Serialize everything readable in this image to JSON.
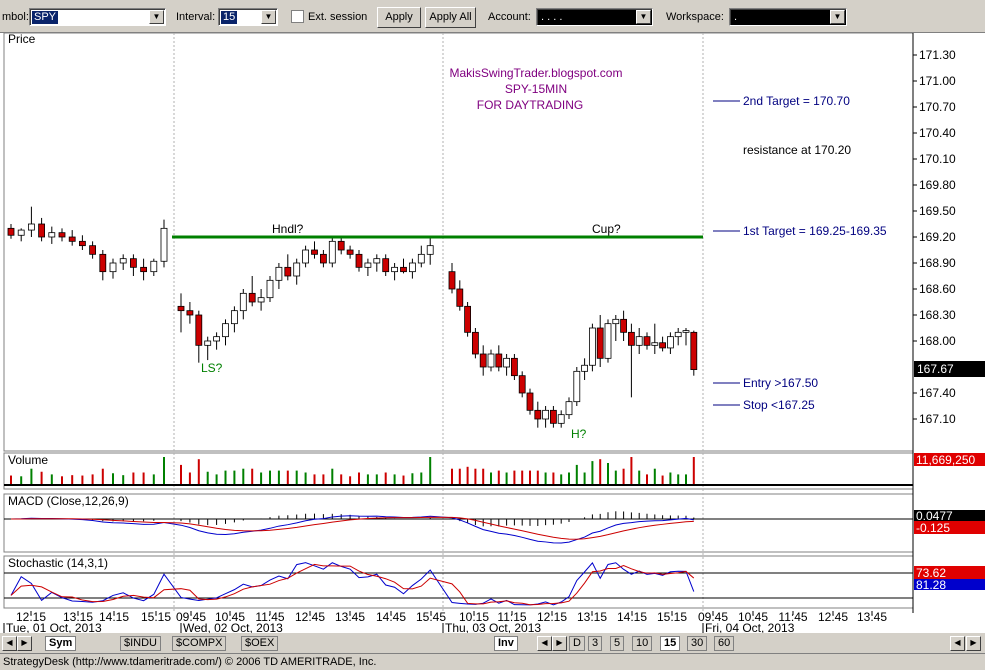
{
  "toolbar": {
    "symbol_label": "mbol:",
    "symbol_value": "SPY",
    "interval_label": "Interval:",
    "interval_value": "15",
    "ext_session_label": "Ext. session",
    "apply_label": "Apply",
    "apply_all_label": "Apply All",
    "account_label": "Account:",
    "account_value": ".   .   .   .",
    "workspace_label": "Workspace:",
    "workspace_value": "."
  },
  "price_panel": {
    "label": "Price",
    "watermark": [
      "MakisSwingTrader.blogspot.com",
      "SPY-15MIN",
      "FOR DAYTRADING"
    ],
    "price_ticks": [
      "171.30",
      "171.00",
      "170.70",
      "170.40",
      "170.10",
      "169.80",
      "169.50",
      "169.20",
      "168.90",
      "168.60",
      "168.30",
      "168.00",
      "167.40",
      "167.10"
    ],
    "last_price": "167.67",
    "annotations": {
      "second_target": "2nd Target = 170.70",
      "resistance": "resistance at 170.20",
      "first_target": "1st Target = 169.25-169.35",
      "entry": "Entry >167.50",
      "stop": "Stop <167.25",
      "handle": "Hndl?",
      "cup": "Cup?",
      "left_shoulder": "LS?",
      "head": "H?"
    },
    "neckline_price": 169.2
  },
  "volume_panel": {
    "label": "Volume",
    "last_value": "11,669,250"
  },
  "macd_panel": {
    "label": "MACD (Close,12,26,9)",
    "value1": "0.0477",
    "value2": "-0.125"
  },
  "stoch_panel": {
    "label": "Stochastic (14,3,1)",
    "value1": "73.62",
    "value2": "81.28"
  },
  "time_axis": {
    "times": [
      "12:15",
      "13:15",
      "14:15",
      "15:15",
      "09:45",
      "10:45",
      "11:45",
      "12:45",
      "13:45",
      "14:45",
      "15:45",
      "10:15",
      "11:15",
      "12:15",
      "13:15",
      "14:15",
      "15:15",
      "09:45",
      "10:45",
      "11:45",
      "12:45",
      "13:45"
    ],
    "dates": [
      "Tue, 01 Oct, 2013",
      "Wed, 02 Oct, 2013",
      "Thu, 03 Oct, 2013",
      "Fri, 04 Oct, 2013"
    ]
  },
  "tabs": [
    "Sym",
    "$INDU",
    "$COMPX",
    "$OEX",
    "Inv",
    "D",
    "3",
    "5",
    "10",
    "15",
    "30",
    "60"
  ],
  "status": "StrategyDesk (http://www.tdameritrade.com/) © 2006 TD AMERITRADE, Inc.",
  "colors": {
    "up": "#ffffff",
    "down": "#cc0000",
    "neckline": "#008000",
    "macd": "#0000cc",
    "signal": "#cc0000",
    "watermark": "#800080",
    "annotation": "#000080"
  },
  "chart_data": {
    "type": "candlestick",
    "title": "",
    "ylim": [
      166.9,
      171.45
    ],
    "candles": [
      [
        169.3,
        169.35,
        169.18,
        169.22
      ],
      [
        169.22,
        169.3,
        169.15,
        169.28
      ],
      [
        169.28,
        169.55,
        169.2,
        169.35
      ],
      [
        169.35,
        169.42,
        169.15,
        169.2
      ],
      [
        169.2,
        169.32,
        169.12,
        169.25
      ],
      [
        169.25,
        169.3,
        169.15,
        169.2
      ],
      [
        169.2,
        169.28,
        169.1,
        169.15
      ],
      [
        169.15,
        169.22,
        169.05,
        169.1
      ],
      [
        169.1,
        169.15,
        168.95,
        169.0
      ],
      [
        169.0,
        169.05,
        168.7,
        168.8
      ],
      [
        168.8,
        168.95,
        168.72,
        168.9
      ],
      [
        168.9,
        169.0,
        168.82,
        168.95
      ],
      [
        168.95,
        169.0,
        168.75,
        168.85
      ],
      [
        168.85,
        168.95,
        168.7,
        168.8
      ],
      [
        168.8,
        168.95,
        168.75,
        168.92
      ],
      [
        168.92,
        169.4,
        168.85,
        169.3
      ],
      [
        168.4,
        168.55,
        168.1,
        168.35
      ],
      [
        168.35,
        168.45,
        168.2,
        168.3
      ],
      [
        168.3,
        168.35,
        167.75,
        167.95
      ],
      [
        167.95,
        168.05,
        167.78,
        168.0
      ],
      [
        168.0,
        168.1,
        167.9,
        168.05
      ],
      [
        168.05,
        168.25,
        167.95,
        168.2
      ],
      [
        168.2,
        168.4,
        168.1,
        168.35
      ],
      [
        168.35,
        168.6,
        168.25,
        168.55
      ],
      [
        168.55,
        168.75,
        168.4,
        168.45
      ],
      [
        168.45,
        168.6,
        168.35,
        168.5
      ],
      [
        168.5,
        168.75,
        168.45,
        168.7
      ],
      [
        168.7,
        168.9,
        168.6,
        168.85
      ],
      [
        168.85,
        169.0,
        168.7,
        168.75
      ],
      [
        168.75,
        168.95,
        168.65,
        168.9
      ],
      [
        168.9,
        169.1,
        168.85,
        169.05
      ],
      [
        169.05,
        169.15,
        168.95,
        169.0
      ],
      [
        169.0,
        169.05,
        168.85,
        168.9
      ],
      [
        168.9,
        169.2,
        168.85,
        169.15
      ],
      [
        169.15,
        169.2,
        169.0,
        169.05
      ],
      [
        169.05,
        169.1,
        168.95,
        169.0
      ],
      [
        169.0,
        169.05,
        168.8,
        168.85
      ],
      [
        168.85,
        168.95,
        168.75,
        168.9
      ],
      [
        168.9,
        169.0,
        168.8,
        168.95
      ],
      [
        168.95,
        169.0,
        168.75,
        168.8
      ],
      [
        168.8,
        168.9,
        168.7,
        168.85
      ],
      [
        168.85,
        168.95,
        168.78,
        168.8
      ],
      [
        168.8,
        168.95,
        168.72,
        168.9
      ],
      [
        168.9,
        169.1,
        168.85,
        169.0
      ],
      [
        169.0,
        169.2,
        168.88,
        169.1
      ],
      [
        168.8,
        168.9,
        168.55,
        168.6
      ],
      [
        168.6,
        168.7,
        168.35,
        168.4
      ],
      [
        168.4,
        168.45,
        168.05,
        168.1
      ],
      [
        168.1,
        168.15,
        167.8,
        167.85
      ],
      [
        167.85,
        167.95,
        167.6,
        167.7
      ],
      [
        167.7,
        167.9,
        167.65,
        167.85
      ],
      [
        167.85,
        167.95,
        167.65,
        167.7
      ],
      [
        167.7,
        167.85,
        167.6,
        167.8
      ],
      [
        167.8,
        167.85,
        167.55,
        167.6
      ],
      [
        167.6,
        167.65,
        167.35,
        167.4
      ],
      [
        167.4,
        167.45,
        167.15,
        167.2
      ],
      [
        167.2,
        167.3,
        167.0,
        167.1
      ],
      [
        167.1,
        167.25,
        167.0,
        167.2
      ],
      [
        167.2,
        167.25,
        167.0,
        167.05
      ],
      [
        167.05,
        167.2,
        167.0,
        167.15
      ],
      [
        167.15,
        167.35,
        167.1,
        167.3
      ],
      [
        167.3,
        167.7,
        167.25,
        167.65
      ],
      [
        167.65,
        167.8,
        167.55,
        167.72
      ],
      [
        167.72,
        168.2,
        167.65,
        168.15
      ],
      [
        168.15,
        168.3,
        167.7,
        167.8
      ],
      [
        167.8,
        168.25,
        167.75,
        168.2
      ],
      [
        168.2,
        168.3,
        168.0,
        168.25
      ],
      [
        168.25,
        168.35,
        168.0,
        168.1
      ],
      [
        168.1,
        168.2,
        167.35,
        167.95
      ],
      [
        167.95,
        168.15,
        167.85,
        168.05
      ],
      [
        168.05,
        168.1,
        167.9,
        167.95
      ],
      [
        167.95,
        168.2,
        167.85,
        167.98
      ],
      [
        167.98,
        168.05,
        167.88,
        167.92
      ],
      [
        167.92,
        168.1,
        167.85,
        168.05
      ],
      [
        168.05,
        168.15,
        167.95,
        168.1
      ],
      [
        168.1,
        168.15,
        167.95,
        168.12
      ],
      [
        168.1,
        168.12,
        167.6,
        167.67
      ]
    ]
  }
}
